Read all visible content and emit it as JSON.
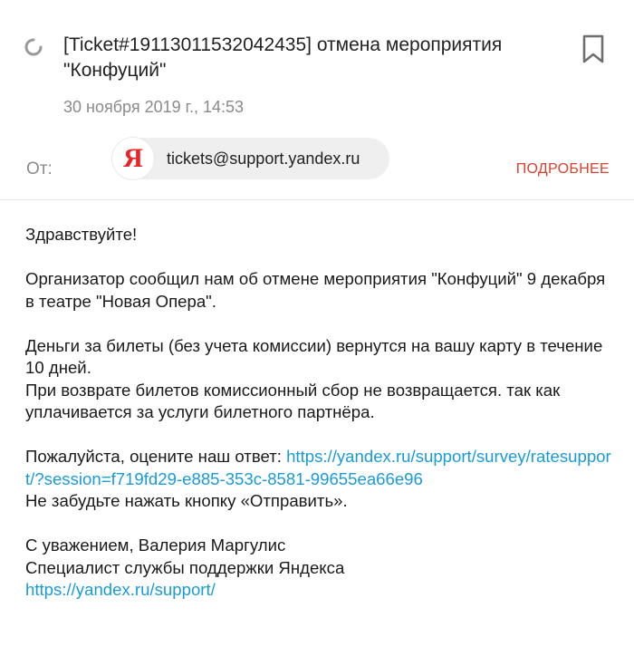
{
  "email": {
    "subject": "[Ticket#19113011532042435] отмена мероприятия \"Конфуций\"",
    "date": "30 ноября 2019 г., 14:53",
    "from_label": "От:",
    "sender_logo_letter": "Я",
    "sender_email": "tickets@support.yandex.ru",
    "details_label": "ПОДРОБНЕЕ",
    "body": {
      "greeting": "Здравствуйте!",
      "para1": "Организатор сообщил нам об отмене мероприятия \"Конфуций\" 9 декабря в театре \"Новая Опера\".",
      "para2_line1": "Деньги за билеты (без учета комиссии) вернутся на вашу карту в течение 10 дней.",
      "para2_line2": "При возврате билетов комиссионный сбор не возвращается. так как уплачивается за услуги билетного партнёра.",
      "rate_text": "Пожалуйста, оцените наш ответ: ",
      "rate_link": "https://yandex.ru/support/survey/ratesupport/?session=f719fd29-e885-353c-8581-99655ea66e96",
      "reminder": "Не забудьте нажать кнопку «Отправить».",
      "signoff": "С уважением, Валерия Маргулис",
      "role": "Специалист службы поддержки Яндекса",
      "support_link": "https://yandex.ru/support/"
    }
  },
  "colors": {
    "accent_red": "#d9412e",
    "link_blue": "#1a9bd6",
    "muted_gray": "#8a8a8a"
  },
  "icons": {
    "status": "loading-spinner-icon",
    "bookmark": "bookmark-icon"
  }
}
